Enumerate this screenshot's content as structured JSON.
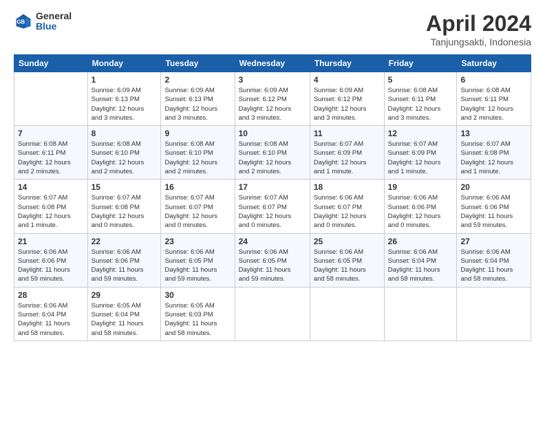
{
  "logo": {
    "general": "General",
    "blue": "Blue"
  },
  "title": "April 2024",
  "location": "Tanjungsakti, Indonesia",
  "weekdays": [
    "Sunday",
    "Monday",
    "Tuesday",
    "Wednesday",
    "Thursday",
    "Friday",
    "Saturday"
  ],
  "weeks": [
    [
      {
        "day": "",
        "info": ""
      },
      {
        "day": "1",
        "info": "Sunrise: 6:09 AM\nSunset: 6:13 PM\nDaylight: 12 hours\nand 3 minutes."
      },
      {
        "day": "2",
        "info": "Sunrise: 6:09 AM\nSunset: 6:13 PM\nDaylight: 12 hours\nand 3 minutes."
      },
      {
        "day": "3",
        "info": "Sunrise: 6:09 AM\nSunset: 6:12 PM\nDaylight: 12 hours\nand 3 minutes."
      },
      {
        "day": "4",
        "info": "Sunrise: 6:09 AM\nSunset: 6:12 PM\nDaylight: 12 hours\nand 3 minutes."
      },
      {
        "day": "5",
        "info": "Sunrise: 6:08 AM\nSunset: 6:11 PM\nDaylight: 12 hours\nand 3 minutes."
      },
      {
        "day": "6",
        "info": "Sunrise: 6:08 AM\nSunset: 6:11 PM\nDaylight: 12 hours\nand 2 minutes."
      }
    ],
    [
      {
        "day": "7",
        "info": "Sunrise: 6:08 AM\nSunset: 6:11 PM\nDaylight: 12 hours\nand 2 minutes."
      },
      {
        "day": "8",
        "info": "Sunrise: 6:08 AM\nSunset: 6:10 PM\nDaylight: 12 hours\nand 2 minutes."
      },
      {
        "day": "9",
        "info": "Sunrise: 6:08 AM\nSunset: 6:10 PM\nDaylight: 12 hours\nand 2 minutes."
      },
      {
        "day": "10",
        "info": "Sunrise: 6:08 AM\nSunset: 6:10 PM\nDaylight: 12 hours\nand 2 minutes."
      },
      {
        "day": "11",
        "info": "Sunrise: 6:07 AM\nSunset: 6:09 PM\nDaylight: 12 hours\nand 1 minute."
      },
      {
        "day": "12",
        "info": "Sunrise: 6:07 AM\nSunset: 6:09 PM\nDaylight: 12 hours\nand 1 minute."
      },
      {
        "day": "13",
        "info": "Sunrise: 6:07 AM\nSunset: 6:08 PM\nDaylight: 12 hours\nand 1 minute."
      }
    ],
    [
      {
        "day": "14",
        "info": "Sunrise: 6:07 AM\nSunset: 6:08 PM\nDaylight: 12 hours\nand 1 minute."
      },
      {
        "day": "15",
        "info": "Sunrise: 6:07 AM\nSunset: 6:08 PM\nDaylight: 12 hours\nand 0 minutes."
      },
      {
        "day": "16",
        "info": "Sunrise: 6:07 AM\nSunset: 6:07 PM\nDaylight: 12 hours\nand 0 minutes."
      },
      {
        "day": "17",
        "info": "Sunrise: 6:07 AM\nSunset: 6:07 PM\nDaylight: 12 hours\nand 0 minutes."
      },
      {
        "day": "18",
        "info": "Sunrise: 6:06 AM\nSunset: 6:07 PM\nDaylight: 12 hours\nand 0 minutes."
      },
      {
        "day": "19",
        "info": "Sunrise: 6:06 AM\nSunset: 6:06 PM\nDaylight: 12 hours\nand 0 minutes."
      },
      {
        "day": "20",
        "info": "Sunrise: 6:06 AM\nSunset: 6:06 PM\nDaylight: 11 hours\nand 59 minutes."
      }
    ],
    [
      {
        "day": "21",
        "info": "Sunrise: 6:06 AM\nSunset: 6:06 PM\nDaylight: 11 hours\nand 59 minutes."
      },
      {
        "day": "22",
        "info": "Sunrise: 6:06 AM\nSunset: 6:06 PM\nDaylight: 11 hours\nand 59 minutes."
      },
      {
        "day": "23",
        "info": "Sunrise: 6:06 AM\nSunset: 6:05 PM\nDaylight: 11 hours\nand 59 minutes."
      },
      {
        "day": "24",
        "info": "Sunrise: 6:06 AM\nSunset: 6:05 PM\nDaylight: 11 hours\nand 59 minutes."
      },
      {
        "day": "25",
        "info": "Sunrise: 6:06 AM\nSunset: 6:05 PM\nDaylight: 11 hours\nand 58 minutes."
      },
      {
        "day": "26",
        "info": "Sunrise: 6:06 AM\nSunset: 6:04 PM\nDaylight: 11 hours\nand 58 minutes."
      },
      {
        "day": "27",
        "info": "Sunrise: 6:06 AM\nSunset: 6:04 PM\nDaylight: 11 hours\nand 58 minutes."
      }
    ],
    [
      {
        "day": "28",
        "info": "Sunrise: 6:06 AM\nSunset: 6:04 PM\nDaylight: 11 hours\nand 58 minutes."
      },
      {
        "day": "29",
        "info": "Sunrise: 6:05 AM\nSunset: 6:04 PM\nDaylight: 11 hours\nand 58 minutes."
      },
      {
        "day": "30",
        "info": "Sunrise: 6:05 AM\nSunset: 6:03 PM\nDaylight: 11 hours\nand 58 minutes."
      },
      {
        "day": "",
        "info": ""
      },
      {
        "day": "",
        "info": ""
      },
      {
        "day": "",
        "info": ""
      },
      {
        "day": "",
        "info": ""
      }
    ]
  ]
}
